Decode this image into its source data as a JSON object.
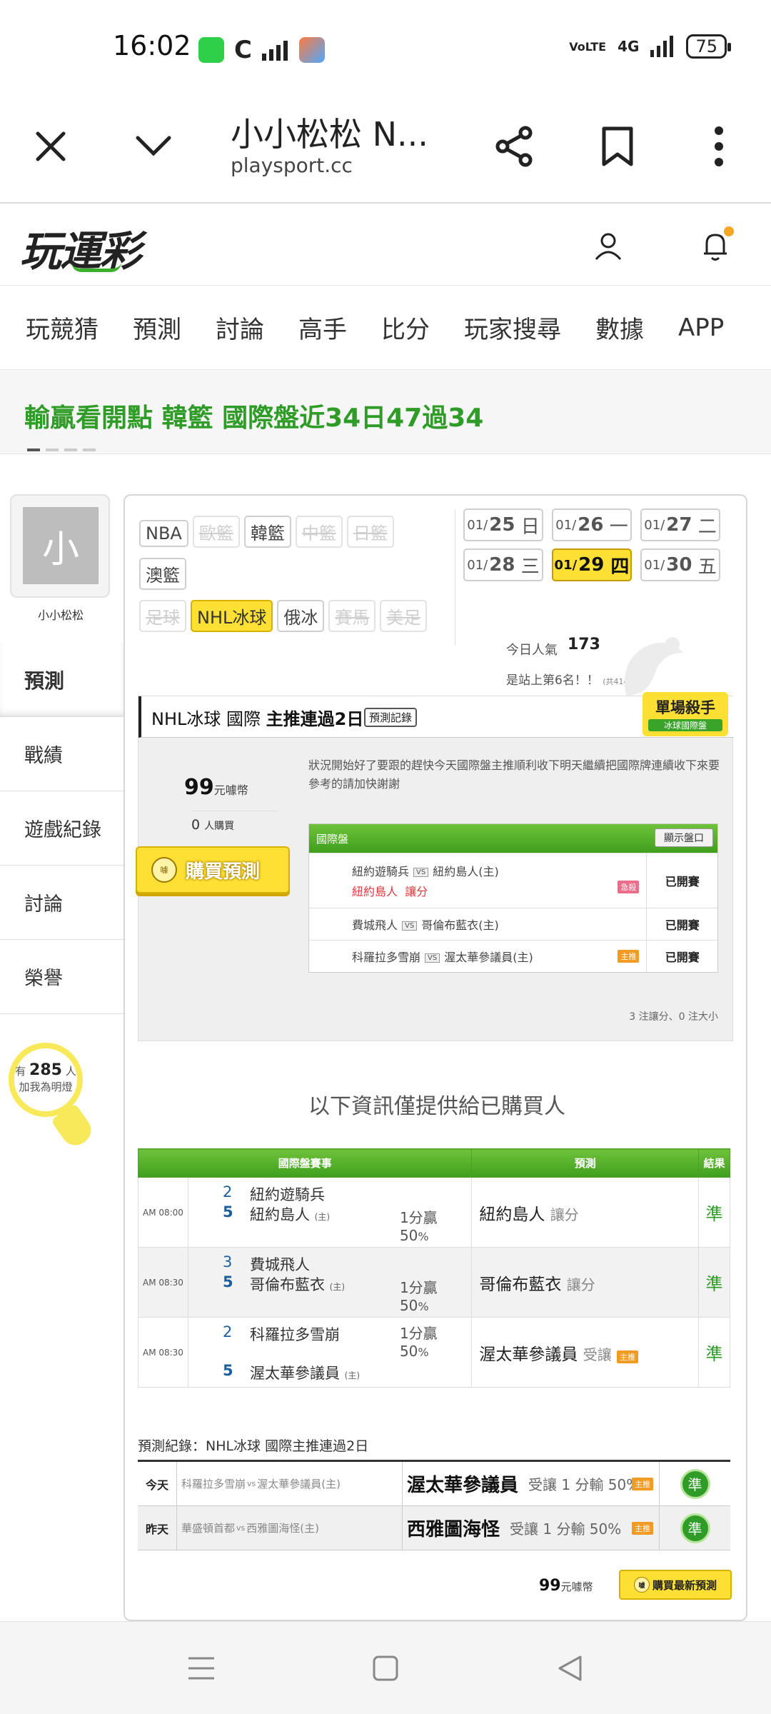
{
  "status_bar": {
    "time": "16:02",
    "network": "4G",
    "volte": "VoLTE",
    "battery": "75"
  },
  "browser": {
    "title": "小小松松 N...",
    "url": "playsport.cc"
  },
  "site": {
    "logo": "玩運彩"
  },
  "nav": [
    "玩競猜",
    "預測",
    "討論",
    "高手",
    "比分",
    "玩家搜尋",
    "數據",
    "APP"
  ],
  "banner": {
    "text": "輸贏看開點 韓籃 國際盤近34日47過34"
  },
  "profile": {
    "avatar_char": "小",
    "name": "小小松松"
  },
  "side_menu": [
    "預測",
    "戰績",
    "遊戲紀錄",
    "討論",
    "榮譽"
  ],
  "fans": {
    "prefix": "有",
    "count": "285",
    "unit": "人",
    "cta": "加我為明燈"
  },
  "categories": [
    {
      "label": "NBA",
      "state": "normal"
    },
    {
      "label": "歐籃",
      "state": "disabled"
    },
    {
      "label": "韓籃",
      "state": "normal"
    },
    {
      "label": "中籃",
      "state": "disabled"
    },
    {
      "label": "日籃",
      "state": "disabled"
    },
    {
      "label": "澳籃",
      "state": "normal"
    },
    {
      "label": "足球",
      "state": "disabled"
    },
    {
      "label": "NHL冰球",
      "state": "selected"
    },
    {
      "label": "俄冰",
      "state": "normal"
    },
    {
      "label": "賽馬",
      "state": "disabled"
    },
    {
      "label": "美足",
      "state": "disabled"
    }
  ],
  "dates": [
    {
      "md": "01/",
      "day": "25",
      "wd": "日"
    },
    {
      "md": "01/",
      "day": "26",
      "wd": "一"
    },
    {
      "md": "01/",
      "day": "27",
      "wd": "二"
    },
    {
      "md": "01/",
      "day": "28",
      "wd": "三"
    },
    {
      "md": "01/",
      "day": "29",
      "wd": "四",
      "selected": true
    },
    {
      "md": "01/",
      "day": "30",
      "wd": "五"
    }
  ],
  "popularity": {
    "label": "今日人氣",
    "value": "173",
    "rank": "是站上第6名！！",
    "total": "(共4143人)"
  },
  "pick": {
    "league": "NHL冰球 國際",
    "streak": "主推連過2日",
    "record_btn": "預測記錄",
    "badge_title": "單場殺手",
    "badge_sub": "冰球國際盤",
    "price": "99",
    "price_unit": "元噱幣",
    "buyers": "0",
    "buyers_unit": "人購買",
    "buy_btn": "購買預測",
    "buy_icon_text": "噱",
    "analysis": "狀況開始好了要跟的趕快今天國際盤主推順利收下明天繼續把國際牌連續收下來要參考的請加快謝謝",
    "table_head": "國際盤",
    "show_btn": "顯示盤口",
    "summary": "3 注讓分、0 注大小",
    "vs": "VS",
    "games": [
      {
        "away": "紐約遊騎兵",
        "home": "紐約島人(主)",
        "pick_team": "紐約島人",
        "pick_type": "讓分",
        "tag": "急殺",
        "status": "已開賽"
      },
      {
        "away": "費城飛人",
        "home": "哥倫布藍衣(主)",
        "status": "已開賽"
      },
      {
        "away": "科羅拉多雪崩",
        "home": "渥太華參議員(主)",
        "tag": "主推",
        "status": "已開賽"
      }
    ]
  },
  "notice": "以下資訊僅提供給已購買人",
  "results": {
    "headers": [
      "國際盤賽事",
      "預測",
      "結果"
    ],
    "home_mark": "(主)",
    "rows": [
      {
        "time": "AM 08:00",
        "away_score": "2",
        "away": "紐約遊騎兵",
        "home_score": "5",
        "home": "紐約島人",
        "line": "1分贏",
        "pct": "50",
        "pct_unit": "%",
        "pick": "紐約島人",
        "pick_type": "讓分",
        "result": "準"
      },
      {
        "time": "AM 08:30",
        "away_score": "3",
        "away": "費城飛人",
        "home_score": "5",
        "home": "哥倫布藍衣",
        "line": "1分贏",
        "pct": "50",
        "pct_unit": "%",
        "pick": "哥倫布藍衣",
        "pick_type": "讓分",
        "result": "準"
      },
      {
        "time": "AM 08:30",
        "away_score": "2",
        "away": "科羅拉多雪崩",
        "home_score": "5",
        "home": "渥太華參議員",
        "line": "1分贏",
        "pct": "50",
        "pct_unit": "%",
        "pick": "渥太華參議員",
        "pick_type": "受讓",
        "tag": "主推",
        "result": "準"
      }
    ]
  },
  "record": {
    "label": "預測紀錄：NHL冰球 國際主推連過2日",
    "rows": [
      {
        "day": "今天",
        "away": "科羅拉多雪崩",
        "vs": "vs",
        "home": "渥太華參議員(主)",
        "pick": "渥太華參議員",
        "detail": "受讓 1 分輸 50%",
        "tag": "主推",
        "result": "準"
      },
      {
        "day": "昨天",
        "away": "華盛頓首都",
        "vs": "vs",
        "home": "西雅圖海怪(主)",
        "pick": "西雅圖海怪",
        "detail": "受讓 1 分輸 50%",
        "tag": "主推",
        "result": "準"
      }
    ]
  },
  "footer": {
    "price": "99",
    "price_unit": "元噱幣",
    "btn": "購買最新預測",
    "btn_icon_text": "噱"
  }
}
